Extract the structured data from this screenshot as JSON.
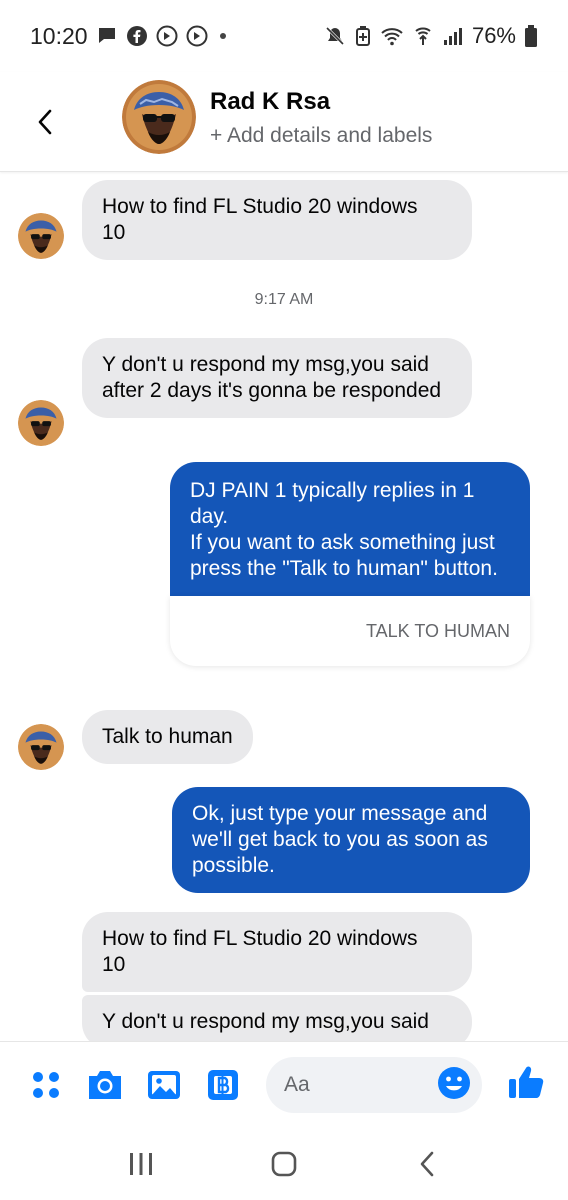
{
  "status_bar": {
    "time": "10:20",
    "battery": "76%",
    "icons": [
      "messenger-notification-icon",
      "facebook-icon",
      "app-notification-icon",
      "app-notification-icon",
      "dot-icon",
      "mute-icon",
      "battery-saver-icon",
      "wifi-icon",
      "hotspot-icon",
      "signal-icon",
      "battery-icon"
    ]
  },
  "header": {
    "name": "Rad K Rsa",
    "subtitle": "+ Add details and labels"
  },
  "thread": {
    "timestamp": "9:17 AM",
    "messages": [
      {
        "from": "contact",
        "text": "How to find FL Studio 20 windows\n10"
      },
      {
        "from": "contact",
        "text": "Y don't u respond my msg,you said after 2 days it's gonna be responded"
      },
      {
        "from": "page",
        "text": "DJ PAIN 1 typically replies in 1 day.\n If you want to ask something just press the \"Talk to human\" button.",
        "button": "TALK TO HUMAN"
      },
      {
        "from": "contact",
        "text": "Talk to human"
      },
      {
        "from": "page",
        "text": "Ok, just type your message and we'll get back to you as soon as possible."
      },
      {
        "from": "contact",
        "text": "How to find FL Studio 20 windows\n10"
      },
      {
        "from": "contact",
        "text": "Y don't u respond my msg,you said"
      }
    ]
  },
  "composer": {
    "placeholder": "Aa",
    "icons": [
      "more-actions-icon",
      "camera-icon",
      "gallery-icon",
      "pay-icon",
      "emoji-icon",
      "like-icon"
    ]
  },
  "colors": {
    "accent": "#0a7cff",
    "outgoing_bubble": "#1456b8",
    "incoming_bubble": "#e9e9eb"
  }
}
